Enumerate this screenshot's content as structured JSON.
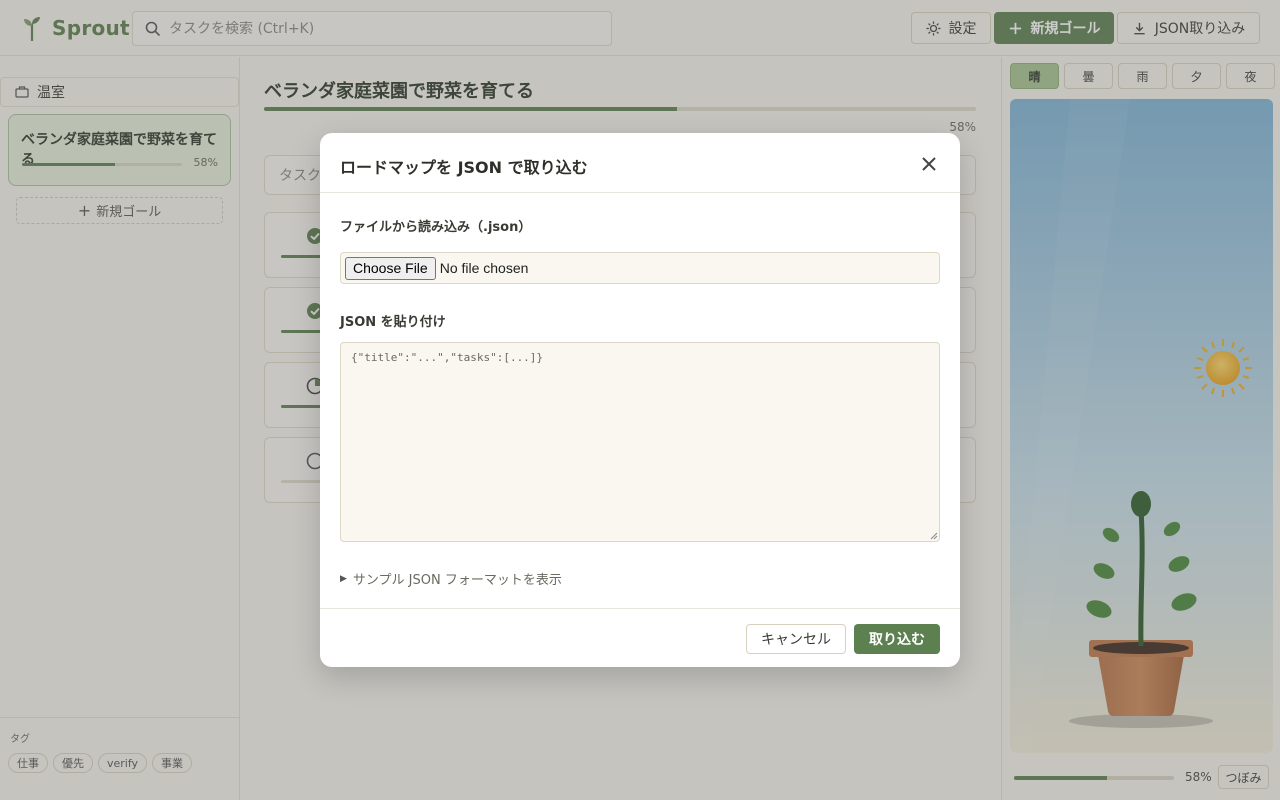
{
  "app": {
    "name": "Sprout"
  },
  "header": {
    "search_placeholder": "タスクを検索 (Ctrl+K)",
    "settings_label": "設定",
    "new_goal_label": "新規ゴール",
    "import_label": "JSON取り込み"
  },
  "sidebar": {
    "section_label": "温室",
    "goals": [
      {
        "title": "ベランダ家庭菜園で野菜を育てる",
        "progress_pct": 58,
        "progress_label": "58%"
      }
    ],
    "new_goal_label": "新規ゴール",
    "tags_label": "タグ",
    "tags": [
      "仕事",
      "優先",
      "verify",
      "事業"
    ]
  },
  "main": {
    "title": "ベランダ家庭菜園で野菜を育てる",
    "progress_pct": 58,
    "progress_label": "58%",
    "task_input_placeholder": "タスク",
    "tasks": [
      {
        "status": "done",
        "progress_pct": 100
      },
      {
        "status": "done",
        "progress_pct": 100
      },
      {
        "status": "in-progress",
        "progress_pct": 40
      },
      {
        "status": "todo",
        "progress_pct": 0
      }
    ]
  },
  "right_panel": {
    "weather_tabs": [
      "晴",
      "曇",
      "雨",
      "夕",
      "夜"
    ],
    "active_weather": "晴",
    "progress_pct": 58,
    "progress_label": "58%",
    "stage_label": "つぼみ"
  },
  "modal": {
    "title": "ロードマップを JSON で取り込む",
    "file_label": "ファイルから読み込み（.json）",
    "choose_file_label": "Choose File",
    "no_file_label": "No file chosen",
    "json_label": "JSON を貼り付け",
    "json_placeholder": "{\"title\":\"...\",\"tasks\":[...]}",
    "sample_toggle_label": "サンプル JSON フォーマットを表示",
    "cancel_label": "キャンセル",
    "submit_label": "取り込む"
  },
  "colors": {
    "accent": "#5d8050",
    "background": "#f6f4ec",
    "active_tab": "#a8c592"
  },
  "icons": [
    "sprout-logo-icon",
    "search-icon",
    "sun-icon",
    "plus-icon",
    "download-icon",
    "greenhouse-icon",
    "check-circle-icon",
    "half-circle-icon",
    "empty-circle-icon",
    "close-icon"
  ]
}
